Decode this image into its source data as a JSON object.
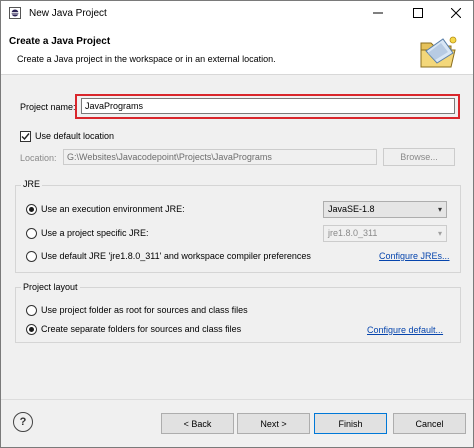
{
  "window": {
    "title": "New Java Project",
    "controls": {
      "minimize": "─",
      "maximize": "☐",
      "close": "✕"
    }
  },
  "header": {
    "title": "Create a Java Project",
    "description": "Create a Java project in the workspace or in an external location.",
    "icon": "folder-new-project-icon"
  },
  "project_name": {
    "label": "Project name:",
    "value": "JavaPrograms"
  },
  "location": {
    "use_default_label": "Use default location",
    "use_default_checked": true,
    "label": "Location:",
    "value": "G:\\Websites\\Javacodepoint\\Projects\\JavaPrograms",
    "browse_label": "Browse..."
  },
  "jre": {
    "group_title": "JRE",
    "options": [
      {
        "label": "Use an execution environment JRE:",
        "selected": true
      },
      {
        "label": "Use a project specific JRE:",
        "selected": false
      },
      {
        "label": "Use default JRE 'jre1.8.0_311' and workspace compiler preferences",
        "selected": false
      }
    ],
    "execution_env_value": "JavaSE-1.8",
    "project_jre_value": "jre1.8.0_311",
    "configure_link": "Configure JREs..."
  },
  "layout": {
    "group_title": "Project layout",
    "options": [
      {
        "label": "Use project folder as root for sources and class files",
        "selected": false
      },
      {
        "label": "Create separate folders for sources and class files",
        "selected": true
      }
    ],
    "configure_link": "Configure default..."
  },
  "footer": {
    "help": "?",
    "back": "< Back",
    "next": "Next >",
    "finish": "Finish",
    "cancel": "Cancel"
  },
  "colors": {
    "highlight": "#d9262c",
    "link": "#0645ad",
    "default_button_border": "#0078d7"
  }
}
